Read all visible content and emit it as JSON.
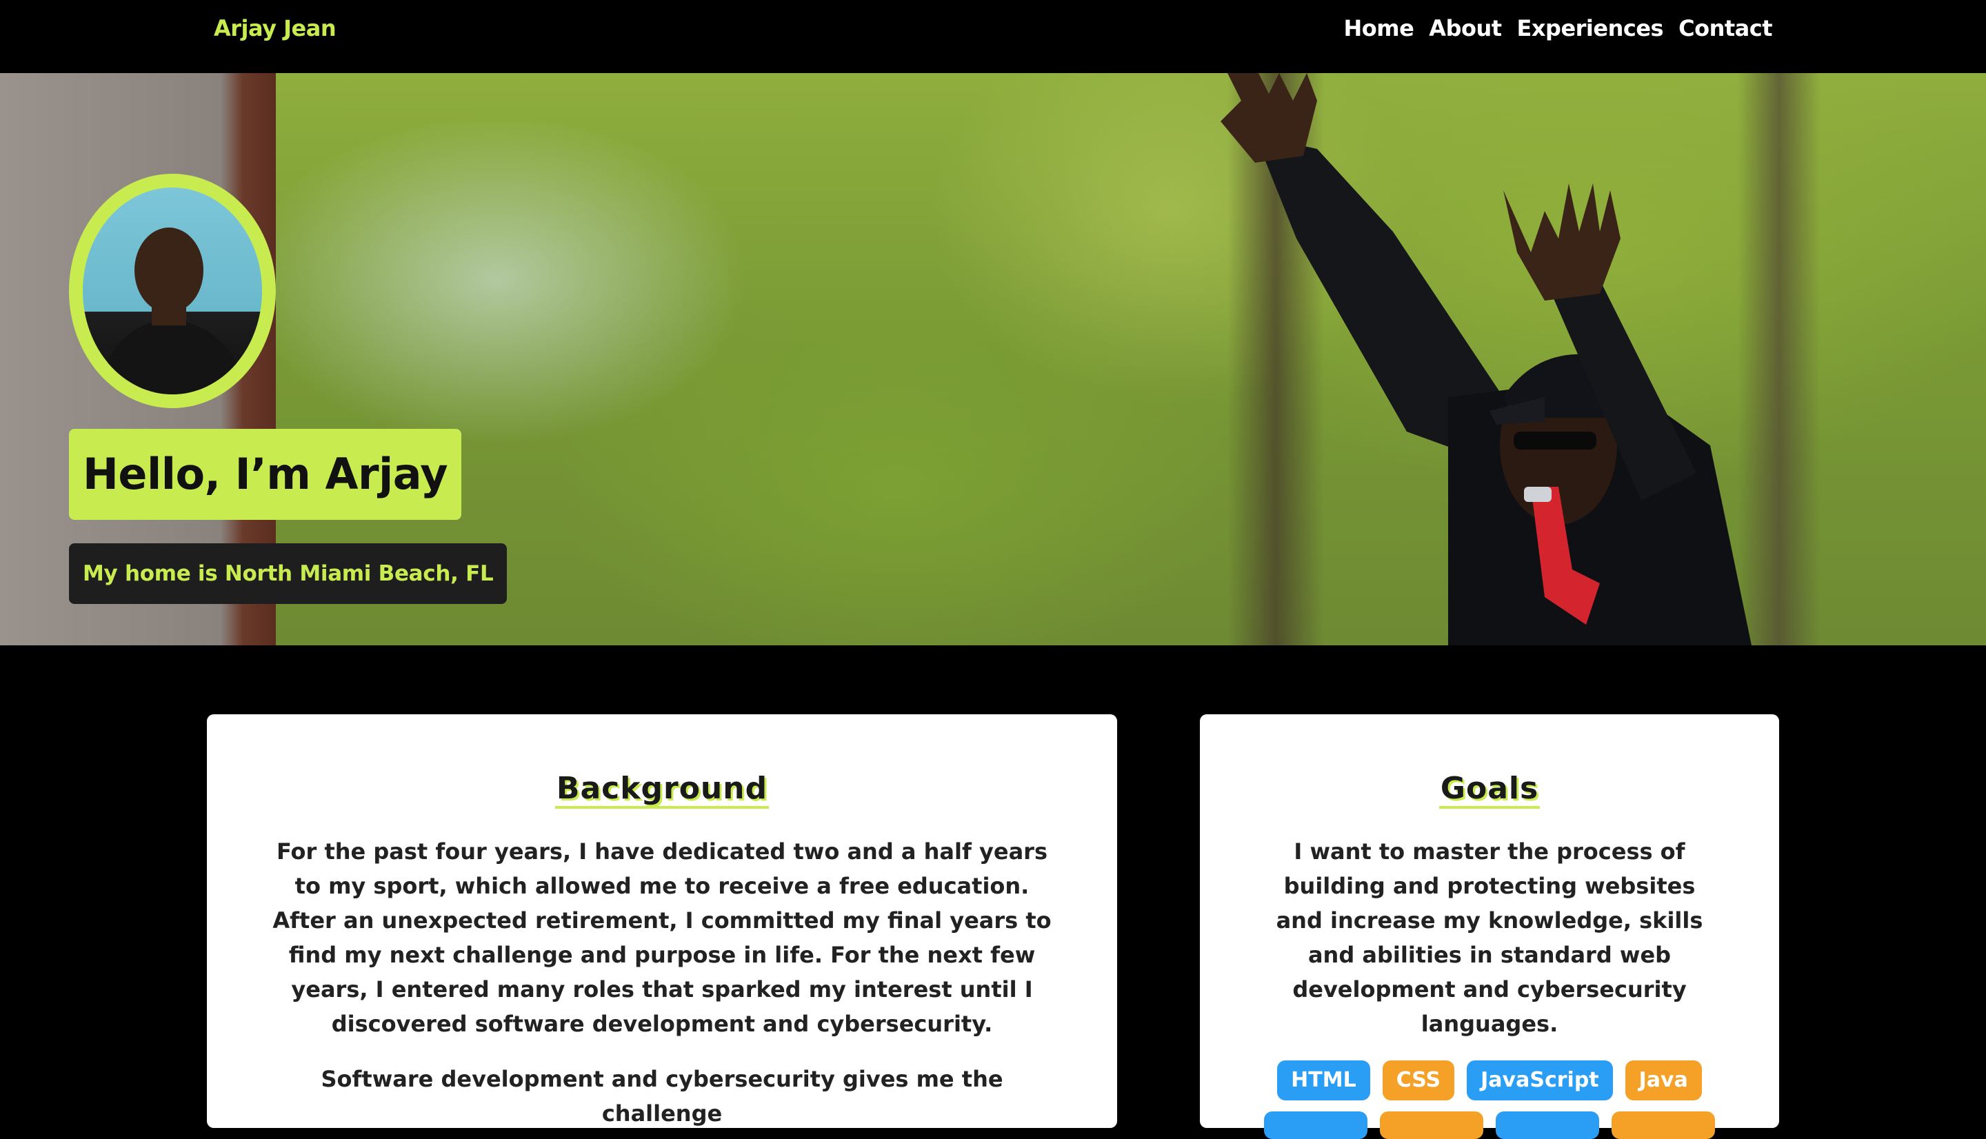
{
  "nav": {
    "brand": "Arjay Jean",
    "links": [
      "Home",
      "About",
      "Experiences",
      "Contact"
    ]
  },
  "hero": {
    "greeting": "Hello, I’m Arjay",
    "home": "My home is North Miami Beach, FL"
  },
  "background": {
    "title": "Background",
    "paragraph1": "For the past four years, I have dedicated two and a half years to my sport, which allowed me to receive a free education. After an unexpected retirement, I committed my final years to find my next challenge and purpose in life. For the next few years, I entered many roles that sparked my interest until I discovered software development and cybersecurity.",
    "paragraph2": "Software development and cybersecurity gives me the challenge"
  },
  "goals": {
    "title": "Goals",
    "paragraph": "I want to master the process of building and protecting websites and increase my knowledge, skills and abilities in standard web development and cybersecurity languages.",
    "tags": [
      "HTML",
      "CSS",
      "JavaScript",
      "Java"
    ]
  },
  "colors": {
    "accent": "#c8ec50",
    "tag_blue": "#2a9df4",
    "tag_orange": "#f5a026"
  }
}
